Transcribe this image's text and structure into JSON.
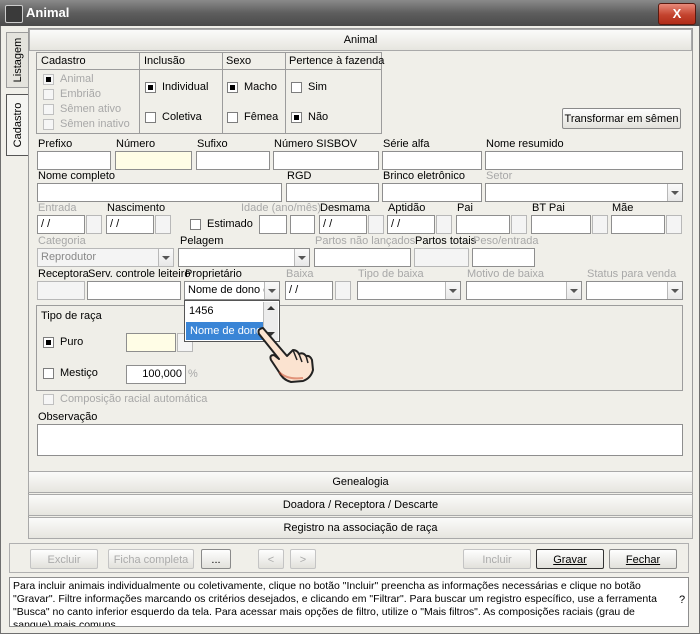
{
  "window": {
    "title": "Animal",
    "close_label": "X"
  },
  "tabs": {
    "listagem": "Listagem",
    "cadastro": "Cadastro"
  },
  "section_header": "Animal",
  "groups": {
    "cadastro": {
      "title": "Cadastro",
      "items": [
        "Animal",
        "Embrião",
        "Sêmen ativo",
        "Sêmen inativo"
      ]
    },
    "inclusao": {
      "title": "Inclusão",
      "items": [
        "Individual",
        "Coletiva"
      ]
    },
    "sexo": {
      "title": "Sexo",
      "items": [
        "Macho",
        "Fêmea"
      ]
    },
    "pertence": {
      "title": "Pertence à fazenda",
      "items": [
        "Sim",
        "Não"
      ]
    }
  },
  "buttons": {
    "transformar": "Transformar em sêmen",
    "excluir": "Excluir",
    "ficha": "Ficha completa",
    "more": "...",
    "prev": "<",
    "next": ">",
    "incluir": "Incluir",
    "gravar": "Gravar",
    "fechar": "Fechar"
  },
  "fields": {
    "prefixo": "Prefixo",
    "numero": "Número",
    "sufixo": "Sufixo",
    "sisbov": "Número SISBOV",
    "serie": "Série alfa",
    "nome_resumido": "Nome resumido",
    "nome_completo": "Nome completo",
    "rgd": "RGD",
    "brinco": "Brinco eletrônico",
    "setor": "Setor",
    "entrada": "Entrada",
    "nascimento": "Nascimento",
    "idade": "Idade (ano/mês)",
    "desmama": "Desmama",
    "aptidao": "Aptidão",
    "pai": "Pai",
    "bt_pai": "BT Pai",
    "mae": "Mãe",
    "estimado": "Estimado",
    "categoria": "Categoria",
    "categoria_value": "Reprodutor",
    "pelagem": "Pelagem",
    "partos_nao": "Partos não lançados",
    "partos_totais": "Partos totais",
    "peso": "Peso/entrada",
    "receptora": "Receptora",
    "serv": "Serv. controle leiteiro",
    "proprietario": "Proprietário",
    "proprietario_value": "Nome de dono de",
    "baixa": "Baixa",
    "tipo_baixa": "Tipo de baixa",
    "motivo_baixa": "Motivo de baixa",
    "status_venda": "Status para venda",
    "date_mask": "/ /"
  },
  "dropdown": {
    "items": [
      "1456",
      "Nome de dono"
    ]
  },
  "raca": {
    "title": "Tipo de raça",
    "puro": "Puro",
    "mestico": "Mestiço",
    "pct_value": "100,000",
    "pct_sign": "%",
    "composicao": "Composição racial automática"
  },
  "observacao": "Observação",
  "sections": [
    "Genealogia",
    "Doadora / Receptora / Descarte",
    "Registro na associação de raça"
  ],
  "help_text": "Para incluir animais individualmente ou coletivamente, clique no botão \"Incluir\" preencha as informações necessárias e clique no botão \"Gravar\". Filtre informações marcando os critérios desejados, e clicando em \"Filtrar\". Para buscar um registro específico, use a ferramenta \"Busca\" no canto inferior esquerdo da tela. Para acessar mais opções de filtro, utilize o \"Mais filtros\". As composições raciais (grau de sangue) mais comuns",
  "help_q": "?"
}
